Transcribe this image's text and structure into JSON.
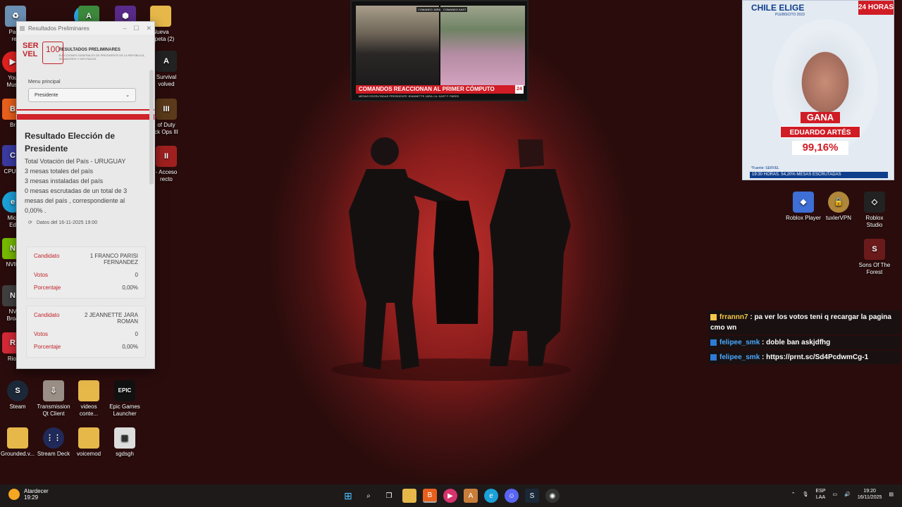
{
  "desktop_icons_left": [
    {
      "label": "Pape\nrec",
      "icon": "recycle-bin-icon"
    },
    {
      "label": "You\nMusi",
      "icon": "youtube-music-icon"
    },
    {
      "label": "Br",
      "icon": "brave-icon"
    },
    {
      "label": "CPUID",
      "icon": "cpuid-icon"
    },
    {
      "label": "Micr\nEd",
      "icon": "edge-icon"
    },
    {
      "label": "NVID",
      "icon": "nvidia-icon"
    },
    {
      "label": "NV\nBroa",
      "icon": "nvidia-broadcast-icon"
    },
    {
      "label": "Riot",
      "icon": "riot-icon"
    }
  ],
  "desktop_icons_col2": [
    {
      "label": "Nueva\ncarpeta (2)"
    },
    {
      "label": "Survival\nvolved"
    },
    {
      "label": "of Duty\nck Ops III"
    },
    {
      "label": "- Acceso\nrecto"
    }
  ],
  "desktop_icons_bottom": [
    {
      "label": "Steam",
      "icon": "steam-icon"
    },
    {
      "label": "Transmission\nQt Client",
      "icon": "transmission-icon"
    },
    {
      "label": "videos\nconte...",
      "icon": "folder-icon"
    },
    {
      "label": "Epic Games\nLauncher",
      "icon": "epic-games-icon",
      "glyph": "EPIC"
    },
    {
      "label": "Grounded.v...",
      "icon": "folder-icon"
    },
    {
      "label": "Stream Deck",
      "icon": "stream-deck-icon"
    },
    {
      "label": "voicemod",
      "icon": "folder-icon"
    },
    {
      "label": "sgdsgh",
      "icon": "image-file-icon"
    }
  ],
  "desktop_icons_right": [
    {
      "label": "Roblox Player",
      "icon": "roblox-icon"
    },
    {
      "label": "tuxlerVPN",
      "icon": "vpn-icon"
    },
    {
      "label": "Roblox\nStudio",
      "icon": "roblox-studio-icon"
    },
    {
      "label": "Sons Of The\nForest",
      "icon": "sons-forest-icon"
    }
  ],
  "window": {
    "title": "Resultados Preliminares",
    "brand_text": "SER\nVEL",
    "badge_text": "100",
    "heading": "RESULTADOS PRELIMINARES",
    "subheading": "ELECCIONES GENERALES DE PRESIDENTE DE LA REPÚBLICA, SENADORES Y DIPUTADOS",
    "menu_label": "Menu principal",
    "menu_value": "Presidente",
    "result_title": "Resultado Elección de Presidente",
    "lines": [
      "Total Votación del País - URUGUAY",
      "3 mesas totales del país",
      "3 mesas instaladas del país",
      "0 mesas escrutadas de un total de 3 mesas del país , correspondiente al 0,00% ."
    ],
    "updated": "Datos del 16-11-2025 19:00",
    "candidates": [
      {
        "k_candidate": "Candidato",
        "name": "1 FRANCO PARISI FERNANDEZ",
        "k_votes": "Votos",
        "votes": "0",
        "k_pct": "Porcentaje",
        "pct": "0,00%"
      },
      {
        "k_candidate": "Candidato",
        "name": "2 JEANNETTE JARA ROMAN",
        "k_votes": "Votos",
        "votes": "0",
        "k_pct": "Porcentaje",
        "pct": "0,00%"
      }
    ]
  },
  "news": {
    "tag_left": "COMANDO JARA",
    "tag_right": "COMANDO KAST",
    "banner": "COMANDOS REACCIONAN AL PRIMER CÓMPUTO",
    "logo": "24",
    "ticker": "MESAS ESCRUTADAS   PRESIDENTE   JEANNETTE JARA   J.A. KAST   F. PARISI"
  },
  "elige": {
    "brand": "CHILE ELIGE",
    "sub": "PLEBISCITO 2023",
    "channel": "24 HORAS",
    "gana": "GANA",
    "winner": "EDUARDO ARTÉS",
    "pct": "99,16%",
    "source": "*Fuente: SERVEL",
    "footer": "19:30 HORAS. 54,20% MESAS ESCRUTADAS"
  },
  "chat": [
    {
      "user": "frrannn7",
      "text": ": pa ver los votos teni q recargar la pagina cmo wn",
      "color": "yellow"
    },
    {
      "user": "felipee_smk",
      "text": ": doble ban askjdfhg",
      "color": "blue"
    },
    {
      "user": "felipee_smk",
      "text": ": https://prnt.sc/Sd4PcdwmCg-1",
      "color": "blue"
    }
  ],
  "taskbar": {
    "weather_label": "Atardecer",
    "weather_time": "19:29",
    "apps": [
      "windows-start-icon",
      "search-icon",
      "task-view-icon",
      "file-explorer-icon",
      "brave-icon",
      "media-player-icon",
      "app-icon",
      "edge-icon",
      "discord-icon",
      "steam-icon",
      "obs-icon"
    ],
    "lang_top": "ESP",
    "lang_bottom": "LAA",
    "time": "19:20",
    "date": "16/11/2025"
  }
}
